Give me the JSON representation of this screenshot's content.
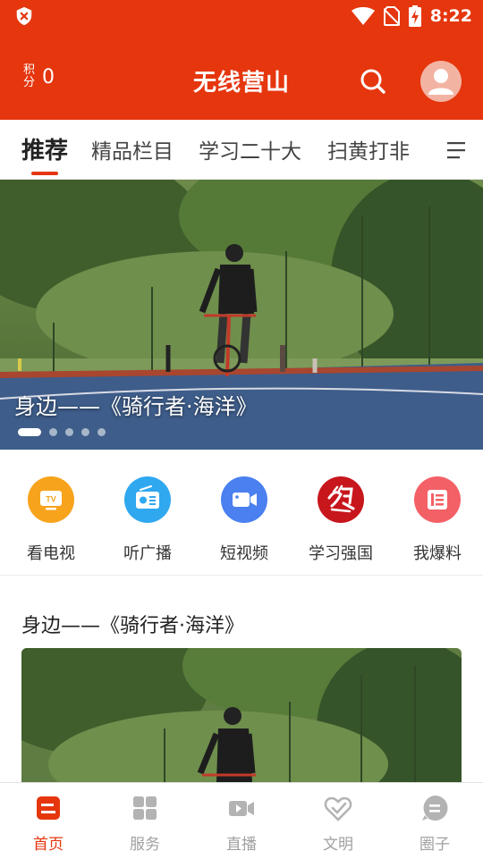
{
  "status_bar": {
    "time": "8:22",
    "icons": [
      "shield-x-icon",
      "wifi-icon",
      "no-sim-icon",
      "battery-charging-icon"
    ]
  },
  "header": {
    "points_label": "积分",
    "points_value": "0",
    "title": "无线营山",
    "search_icon": "search-icon",
    "avatar_icon": "user-avatar-icon"
  },
  "tabs": {
    "items": [
      {
        "label": "推荐",
        "active": true
      },
      {
        "label": "精品栏目",
        "active": false
      },
      {
        "label": "学习二十大",
        "active": false
      },
      {
        "label": "扫黄打非",
        "active": false
      }
    ],
    "menu_icon": "menu-icon"
  },
  "banner": {
    "caption": "身边——《骑行者·海洋》",
    "slide_count": 5,
    "active_slide": 1
  },
  "quick_links": [
    {
      "label": "看电视",
      "icon": "tv-icon",
      "color": "#f7a31c"
    },
    {
      "label": "听广播",
      "icon": "radio-icon",
      "color": "#2fa8ef"
    },
    {
      "label": "短视频",
      "icon": "video-camera-icon",
      "color": "#4a80f0"
    },
    {
      "label": "学习强国",
      "icon": "xuexi-logo-icon",
      "color": "#c8161d"
    },
    {
      "label": "我爆料",
      "icon": "report-icon",
      "color": "#f36066"
    }
  ],
  "article": {
    "title": "身边——《骑行者·海洋》"
  },
  "bottom_nav": [
    {
      "label": "首页",
      "icon": "home-icon",
      "active": true
    },
    {
      "label": "服务",
      "icon": "grid-icon",
      "active": false
    },
    {
      "label": "直播",
      "icon": "live-video-icon",
      "active": false
    },
    {
      "label": "文明",
      "icon": "heart-hands-icon",
      "active": false
    },
    {
      "label": "圈子",
      "icon": "chat-circle-icon",
      "active": false
    }
  ],
  "colors": {
    "brand": "#e5360e",
    "nav_inactive": "#a0a0a0"
  }
}
